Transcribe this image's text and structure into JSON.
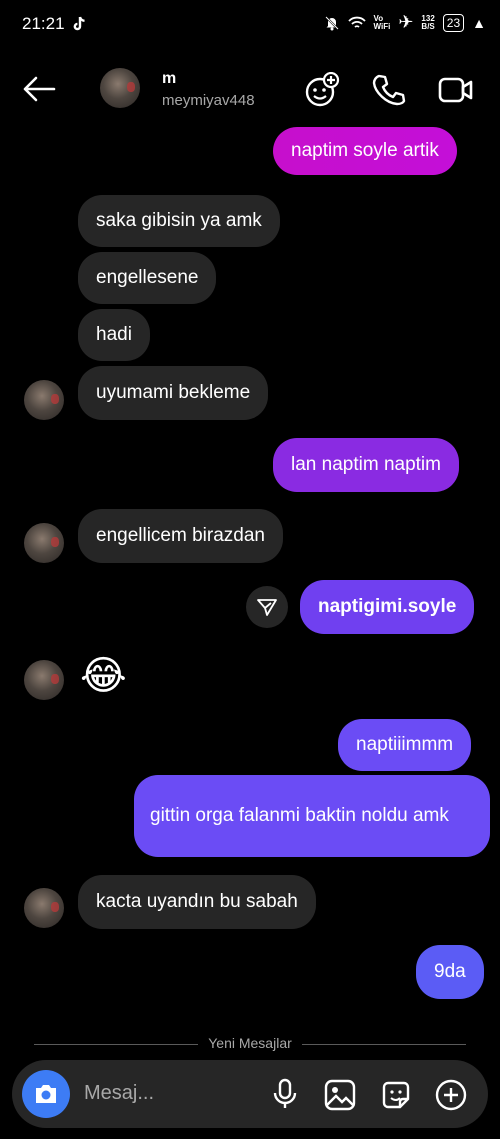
{
  "status_bar": {
    "time": "21:21",
    "vowifi": "Vo\nWiFi",
    "speed": "132\nB/S",
    "battery": "23"
  },
  "header": {
    "name": "m",
    "username": "meymiyav448"
  },
  "messages": [
    {
      "text": "naptim soyle artik"
    },
    {
      "text": "saka gibisin ya amk"
    },
    {
      "text": "engellesene"
    },
    {
      "text": "hadi"
    },
    {
      "text": "uyumami bekleme"
    },
    {
      "text": "lan naptim naptim"
    },
    {
      "text": "engellicem birazdan"
    },
    {
      "text": "naptigimi.soyle"
    },
    {
      "text": "😂"
    },
    {
      "text": "naptiiimmm"
    },
    {
      "text": "gittin orga falanmi baktin noldu amk"
    },
    {
      "text": "kacta uyandın bu sabah"
    },
    {
      "text": "9da"
    }
  ],
  "divider": {
    "label": "Yeni Mesajlar"
  },
  "composer": {
    "placeholder": "Mesaj..."
  },
  "colors": {
    "incoming": "#262626",
    "magenta": "#c20fd4",
    "purple": "#8a2be2",
    "violet": "#6b4cf5",
    "blue": "#5b5cf5"
  }
}
